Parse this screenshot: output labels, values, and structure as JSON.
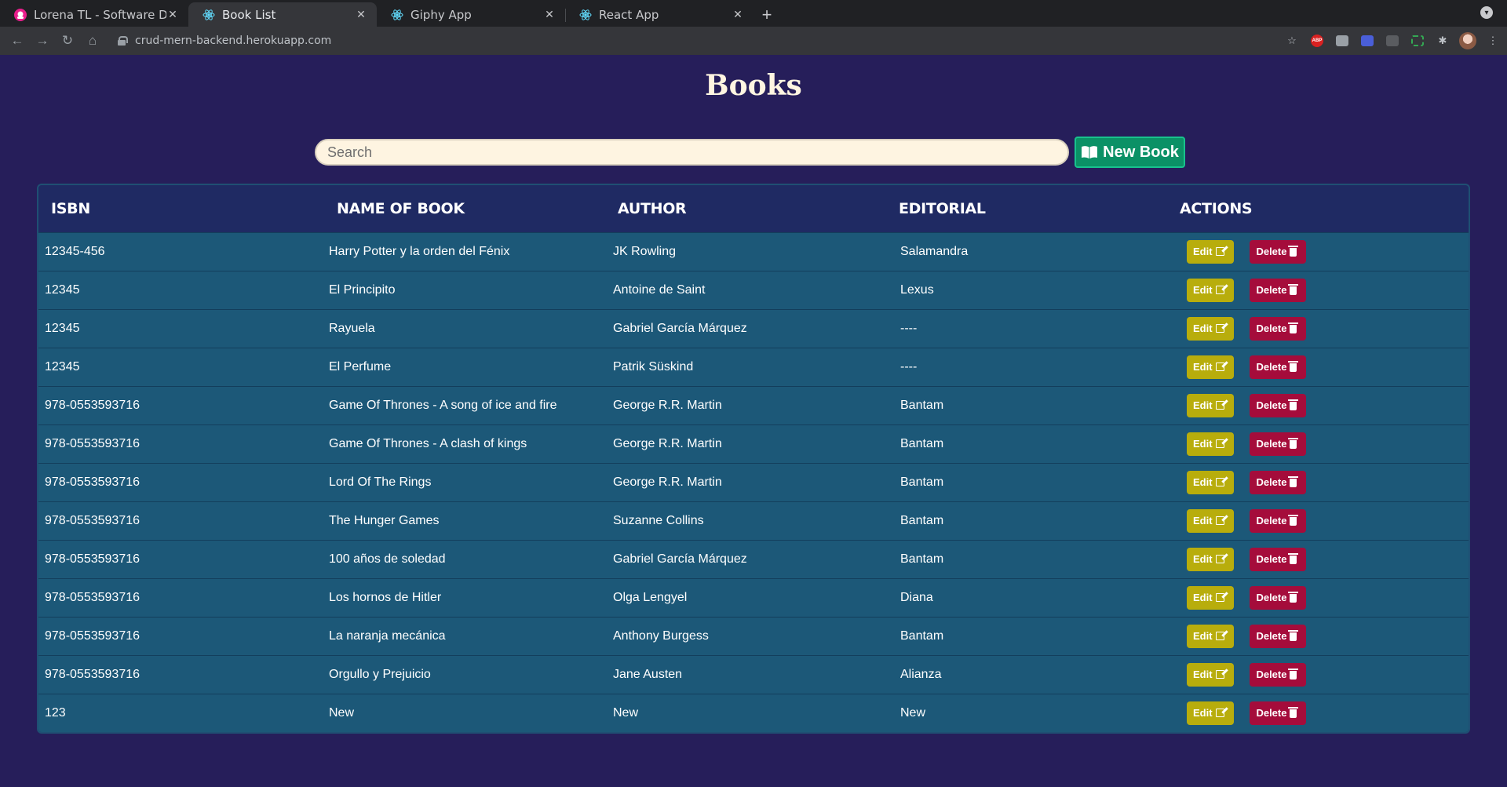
{
  "browser": {
    "tabs": [
      {
        "title": "Lorena TL - Software Developer",
        "favicon": "lorena-logo-icon",
        "active": false
      },
      {
        "title": "Book List",
        "favicon": "react-icon",
        "active": true
      },
      {
        "title": "Giphy App",
        "favicon": "react-icon",
        "active": false
      },
      {
        "title": "React App",
        "favicon": "react-icon",
        "active": false
      }
    ],
    "url": "crud-mern-backend.herokuapp.com"
  },
  "page": {
    "title": "Books",
    "search_placeholder": "Search",
    "new_book_label": "New Book"
  },
  "table": {
    "headers": [
      "ISBN",
      "NAME OF BOOK",
      "AUTHOR",
      "EDITORIAL",
      "ACTIONS"
    ],
    "edit_label": "Edit",
    "delete_label": "Delete",
    "rows": [
      {
        "isbn": "12345-456",
        "name": "Harry Potter y la orden del Fénix",
        "author": "JK Rowling",
        "editorial": "Salamandra"
      },
      {
        "isbn": "12345",
        "name": "El Principito",
        "author": "Antoine de Saint",
        "editorial": "Lexus"
      },
      {
        "isbn": "12345",
        "name": "Rayuela",
        "author": "Gabriel García Márquez",
        "editorial": "----"
      },
      {
        "isbn": "12345",
        "name": "El Perfume",
        "author": "Patrik Süskind",
        "editorial": "----"
      },
      {
        "isbn": "978-0553593716",
        "name": "Game Of Thrones - A song of ice and fire",
        "author": "George R.R. Martin",
        "editorial": "Bantam"
      },
      {
        "isbn": "978-0553593716",
        "name": "Game Of Thrones - A clash of kings",
        "author": "George R.R. Martin",
        "editorial": "Bantam"
      },
      {
        "isbn": "978-0553593716",
        "name": "Lord Of The Rings",
        "author": "George R.R. Martin",
        "editorial": "Bantam"
      },
      {
        "isbn": "978-0553593716",
        "name": "The Hunger Games",
        "author": "Suzanne Collins",
        "editorial": "Bantam"
      },
      {
        "isbn": "978-0553593716",
        "name": "100 años de soledad",
        "author": "Gabriel García Márquez",
        "editorial": "Bantam"
      },
      {
        "isbn": "978-0553593716",
        "name": "Los hornos de Hitler",
        "author": "Olga Lengyel",
        "editorial": "Diana"
      },
      {
        "isbn": "978-0553593716",
        "name": "La naranja mecánica",
        "author": "Anthony Burgess",
        "editorial": "Bantam"
      },
      {
        "isbn": "978-0553593716",
        "name": "Orgullo y Prejuicio",
        "author": "Jane Austen",
        "editorial": "Alianza"
      },
      {
        "isbn": "123",
        "name": "New",
        "author": "New",
        "editorial": "New"
      }
    ]
  },
  "colors": {
    "background": "#261e5a",
    "row": "#1c5878",
    "edit_button": "#b8ad0c",
    "delete_button": "#a50c3b",
    "new_book_button": "#0b9166",
    "title": "#fff5e1"
  }
}
